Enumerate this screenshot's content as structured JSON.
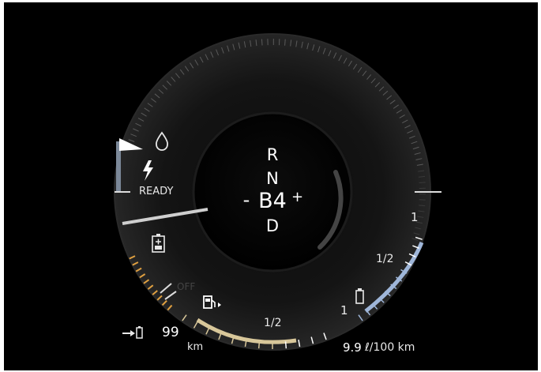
{
  "cluster": {
    "gear": {
      "r": "R",
      "n": "N",
      "minus": "-",
      "current": "B4",
      "plus": "+",
      "d": "D"
    },
    "power_meter": {
      "ready_label": "READY",
      "off_label": "OFF",
      "charge_level": 0.45,
      "regen_level": 0.6
    },
    "fuel": {
      "half_label": "1/2",
      "full_label": "1",
      "level": 0.55,
      "pump_side": "right"
    },
    "battery_gauge": {
      "half_label": "1/2",
      "full_label": "1",
      "level": 0.7
    },
    "range": {
      "value": "99",
      "unit": "km"
    },
    "consumption": {
      "value": "9.9",
      "unit": "ℓ/100 km"
    },
    "colors": {
      "background": "#000000",
      "fuel_bar": "#d8c79a",
      "battery_bar": "#9fb6d9",
      "regen_bar": "#e0a040",
      "charge_bar": "#9aa6b8",
      "text": "#e8e8e8"
    },
    "icons": [
      "oil-drop-icon",
      "lightning-icon",
      "battery-plus-icon",
      "fuel-pump-icon",
      "battery-icon",
      "range-arrow-battery-icon"
    ]
  }
}
